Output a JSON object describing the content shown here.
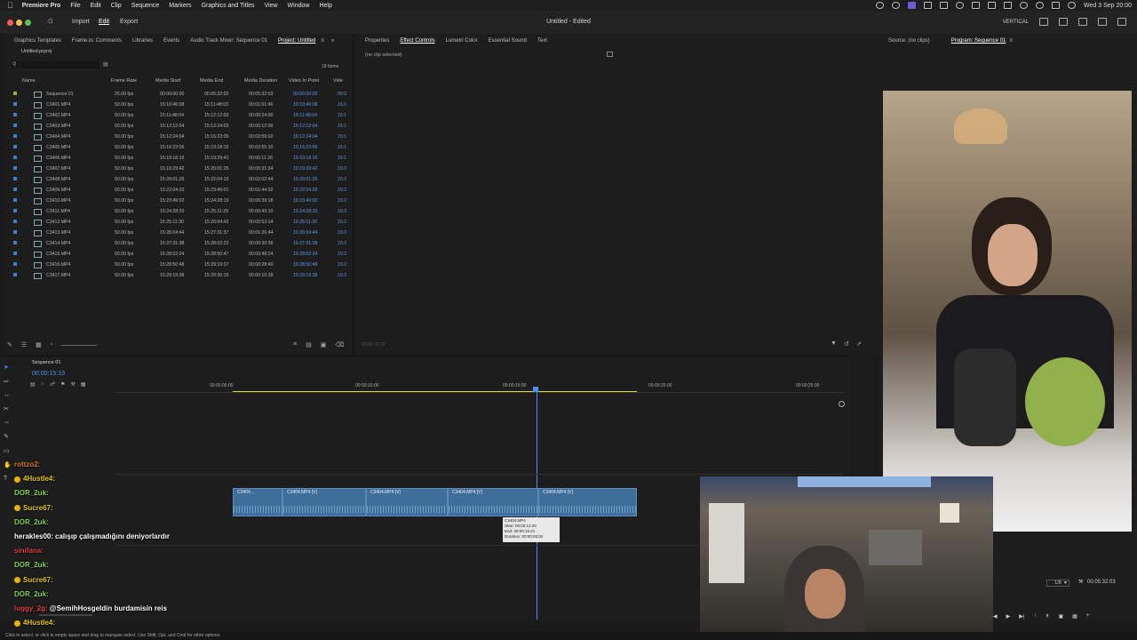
{
  "menubar": {
    "app_name": "Premiere Pro",
    "items": [
      "File",
      "Edit",
      "Clip",
      "Sequence",
      "Markers",
      "Graphics and Titles",
      "View",
      "Window",
      "Help"
    ],
    "datetime": "Wed 3 Sep 20:00"
  },
  "titlebar": {
    "workspaces": [
      "Import",
      "Edit",
      "Export"
    ],
    "active_workspace": "Edit",
    "title": "Untitled - Edited",
    "layout_label": "VERTICAL"
  },
  "project_panel": {
    "tabs": [
      "Graphics Templates",
      "Frame.io: Comments",
      "Libraries",
      "Events",
      "Audio Track Mixer: Sequence 01",
      "Project: Untitled"
    ],
    "active_tab": "Project: Untitled",
    "file": "Untitled.prproj",
    "item_count": "18 Items",
    "columns": [
      "Name",
      "Frame Rate",
      "Media Start",
      "Media End",
      "Media Duration",
      "Video In Point",
      "Vide"
    ],
    "rows": [
      {
        "name": "Sequence 01",
        "fps": "25.00 fps",
        "start": "00:00:00:00",
        "end": "00:05:32:02",
        "dur": "00:05:32:03",
        "vin": "00:00:00:00",
        "v": "00:0"
      },
      {
        "name": "C3401.MP4",
        "fps": "50.00 fps",
        "start": "15:10:46:08",
        "end": "15:11:48:03",
        "dur": "00:01:01:46",
        "vin": "15:10:46:08",
        "v": "15:1"
      },
      {
        "name": "C3402.MP4",
        "fps": "50.00 fps",
        "start": "15:11:48:04",
        "end": "15:12:12:03",
        "dur": "00:00:24:00",
        "vin": "15:11:48:04",
        "v": "15:1"
      },
      {
        "name": "C3403.MP4",
        "fps": "50.00 fps",
        "start": "15:12:12:04",
        "end": "15:12:24:03",
        "dur": "00:00:12:00",
        "vin": "15:12:12:04",
        "v": "15:1"
      },
      {
        "name": "C3404.MP4",
        "fps": "50.00 fps",
        "start": "15:12:24:04",
        "end": "15:16:23:05",
        "dur": "00:03:59:02",
        "vin": "15:12:24:04",
        "v": "15:1"
      },
      {
        "name": "C3405.MP4",
        "fps": "50.00 fps",
        "start": "15:16:23:06",
        "end": "15:19:18:15",
        "dur": "00:02:55:10",
        "vin": "15:16:23:06",
        "v": "15:1"
      },
      {
        "name": "C3406.MP4",
        "fps": "50.00 fps",
        "start": "15:19:18:16",
        "end": "15:19:29:41",
        "dur": "00:00:11:26",
        "vin": "15:19:18:16",
        "v": "15:1"
      },
      {
        "name": "C3407.MP4",
        "fps": "50.00 fps",
        "start": "15:19:29:42",
        "end": "15:20:01:25",
        "dur": "00:00:31:34",
        "vin": "15:19:29:42",
        "v": "15:2"
      },
      {
        "name": "C3408.MP4",
        "fps": "50.00 fps",
        "start": "15:20:01:26",
        "end": "15:22:04:19",
        "dur": "00:02:02:44",
        "vin": "15:20:01:26",
        "v": "15:2"
      },
      {
        "name": "C3409.MP4",
        "fps": "50.00 fps",
        "start": "15:22:04:20",
        "end": "15:23:49:01",
        "dur": "00:01:44:32",
        "vin": "15:22:04:20",
        "v": "15:2"
      },
      {
        "name": "C3410.MP4",
        "fps": "50.00 fps",
        "start": "15:23:49:02",
        "end": "15:24:28:19",
        "dur": "00:00:39:18",
        "vin": "15:23:49:02",
        "v": "15:2"
      },
      {
        "name": "C3411.MP4",
        "fps": "50.00 fps",
        "start": "15:24:28:20",
        "end": "15:25:11:29",
        "dur": "00:00:43:10",
        "vin": "15:24:28:20",
        "v": "15:2"
      },
      {
        "name": "C3412.MP4",
        "fps": "50.00 fps",
        "start": "15:25:11:30",
        "end": "15:26:04:43",
        "dur": "00:00:53:14",
        "vin": "15:25:11:30",
        "v": "15:2"
      },
      {
        "name": "C3413.MP4",
        "fps": "50.00 fps",
        "start": "15:26:04:44",
        "end": "15:27:31:37",
        "dur": "00:01:26:44",
        "vin": "15:26:04:44",
        "v": "15:2"
      },
      {
        "name": "C3414.MP4",
        "fps": "50.00 fps",
        "start": "15:27:31:38",
        "end": "15:28:02:23",
        "dur": "00:00:30:36",
        "vin": "15:27:31:38",
        "v": "15:2"
      },
      {
        "name": "C3415.MP4",
        "fps": "50.00 fps",
        "start": "15:28:02:24",
        "end": "15:28:50:47",
        "dur": "00:00:48:24",
        "vin": "15:28:02:24",
        "v": "15:2"
      },
      {
        "name": "C3416.MP4",
        "fps": "50.00 fps",
        "start": "15:28:50:48",
        "end": "15:29:19:37",
        "dur": "00:00:28:40",
        "vin": "15:28:50:48",
        "v": "15:2"
      },
      {
        "name": "C3417.MP4",
        "fps": "50.00 fps",
        "start": "15:29:19:38",
        "end": "15:29:30:15",
        "dur": "00:00:10:28",
        "vin": "15:29:19:38",
        "v": "15:2"
      }
    ],
    "label_colors": [
      "#8bb84b",
      "#3a7fd0"
    ]
  },
  "effects_panel": {
    "tabs": [
      "Properties",
      "Effect Controls",
      "Lumetri Color",
      "Essential Sound",
      "Text"
    ],
    "active_tab": "Effect Controls",
    "empty_text": "(no clip selected)",
    "timecode": "00:00:15:19"
  },
  "program_panel": {
    "tabs": [
      "Source: (no clips)",
      "Program: Sequence 01"
    ],
    "active_tab": "Program: Sequence 01",
    "zoom": "1/8",
    "duration": "00:05:32:03"
  },
  "timeline": {
    "sequence_tab": "Sequence 01",
    "timecode": "00:00:15:19",
    "ruler": [
      "00:00:05:00",
      "00:00:10:00",
      "00:00:15:00",
      "00:00:20:00",
      "00:00:25:00"
    ],
    "clips": [
      "C3404...",
      "C3404.MP4 [V]",
      "C3404.MP4 [V]",
      "C3404.MP4 [V]",
      "C3404.MP4 [V]"
    ],
    "tooltip": {
      "title": "C3404.MP4",
      "start": "Start: 00:00:12:20",
      "end": "End: 00:00:15:21",
      "duration": "Duration: 00:00:03:02"
    }
  },
  "chat": [
    {
      "user": "rottzo2:",
      "msg": "",
      "color": "#e07a2a"
    },
    {
      "user": "4Hustle4:",
      "msg": "",
      "color": "#e8c800",
      "badge": true
    },
    {
      "user": "DOR_2uk:",
      "msg": "",
      "color": "#7fd94a"
    },
    {
      "user": "Sucre67:",
      "msg": "",
      "color": "#e8c800",
      "badge": true
    },
    {
      "user": "DOR_2uk:",
      "msg": "",
      "color": "#7fd94a"
    },
    {
      "user": "herakles00:",
      "msg": "calışıp çalışmadığını deniyorlardır",
      "color": "#ffffff"
    },
    {
      "user": "sinifana:",
      "msg": "",
      "color": "#e04040"
    },
    {
      "user": "DOR_2uk:",
      "msg": "",
      "color": "#7fd94a"
    },
    {
      "user": "Sucre67:",
      "msg": "",
      "color": "#e8c800",
      "badge": true
    },
    {
      "user": "DOR_2uk:",
      "msg": "",
      "color": "#7fd94a"
    },
    {
      "user": "luggy_2g:",
      "msg": "@SemihHosgeldin burdamisin reis",
      "color": "#e04040"
    },
    {
      "user": "4Hustle4:",
      "msg": "",
      "color": "#e8c800",
      "badge": true
    }
  ],
  "statusbar": {
    "text": "Click to select, or click in empty space and drag to marquee select. Use Shift, Opt, and Cmd for other options."
  }
}
